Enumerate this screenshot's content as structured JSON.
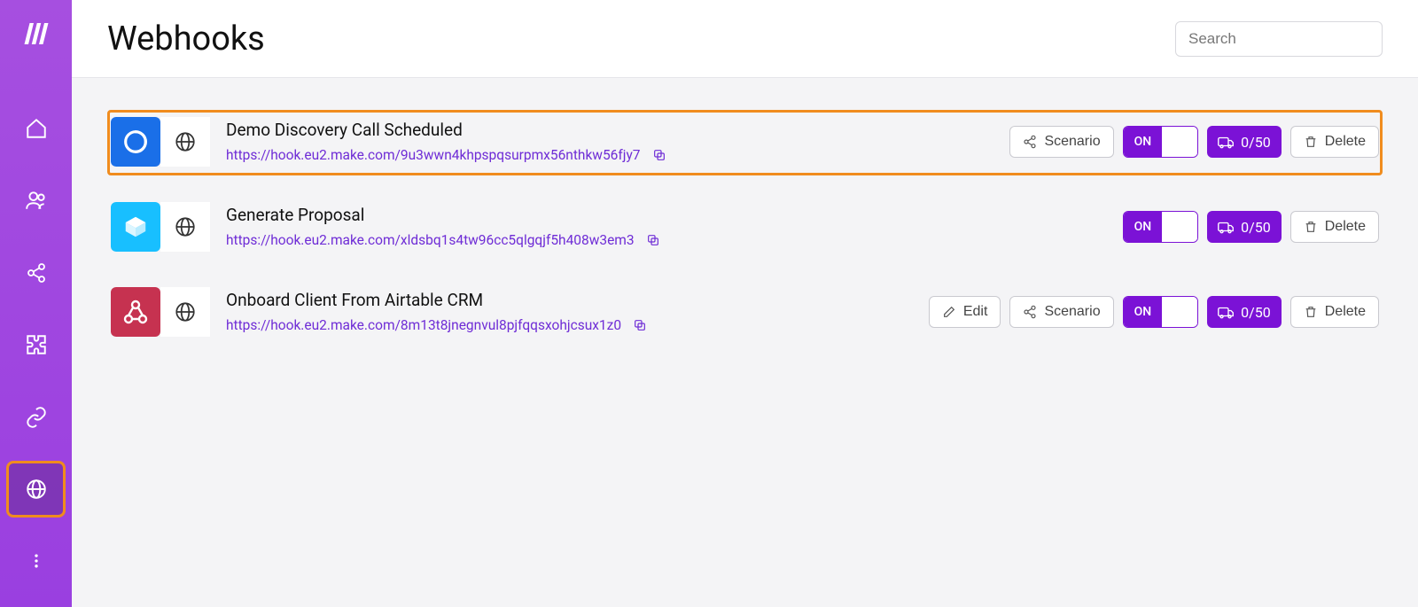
{
  "header": {
    "title": "Webhooks",
    "search_placeholder": "Search"
  },
  "sidebar": {
    "items": [
      "home",
      "users",
      "share",
      "integrations",
      "links",
      "webhooks",
      "more"
    ]
  },
  "buttons": {
    "edit": "Edit",
    "scenario": "Scenario",
    "delete": "Delete",
    "on": "ON"
  },
  "webhooks": [
    {
      "title": "Demo Discovery Call Scheduled",
      "url": "https://hook.eu2.make.com/9u3wwn4khpspqsurpmx56nthkw56fjy7",
      "icon": "calendly",
      "color": "blue",
      "highlight": true,
      "show_edit": false,
      "show_scenario": true,
      "queue": "0/50"
    },
    {
      "title": "Generate Proposal",
      "url": "https://hook.eu2.make.com/xldsbq1s4tw96cc5qlgqjf5h408w3em3",
      "icon": "box",
      "color": "cyan",
      "highlight": false,
      "show_edit": false,
      "show_scenario": false,
      "queue": "0/50"
    },
    {
      "title": "Onboard Client From Airtable CRM",
      "url": "https://hook.eu2.make.com/8m13t8jnegnvul8pjfqqsxohjcsux1z0",
      "icon": "webhook",
      "color": "red",
      "highlight": false,
      "show_edit": true,
      "show_scenario": true,
      "queue": "0/50"
    }
  ]
}
